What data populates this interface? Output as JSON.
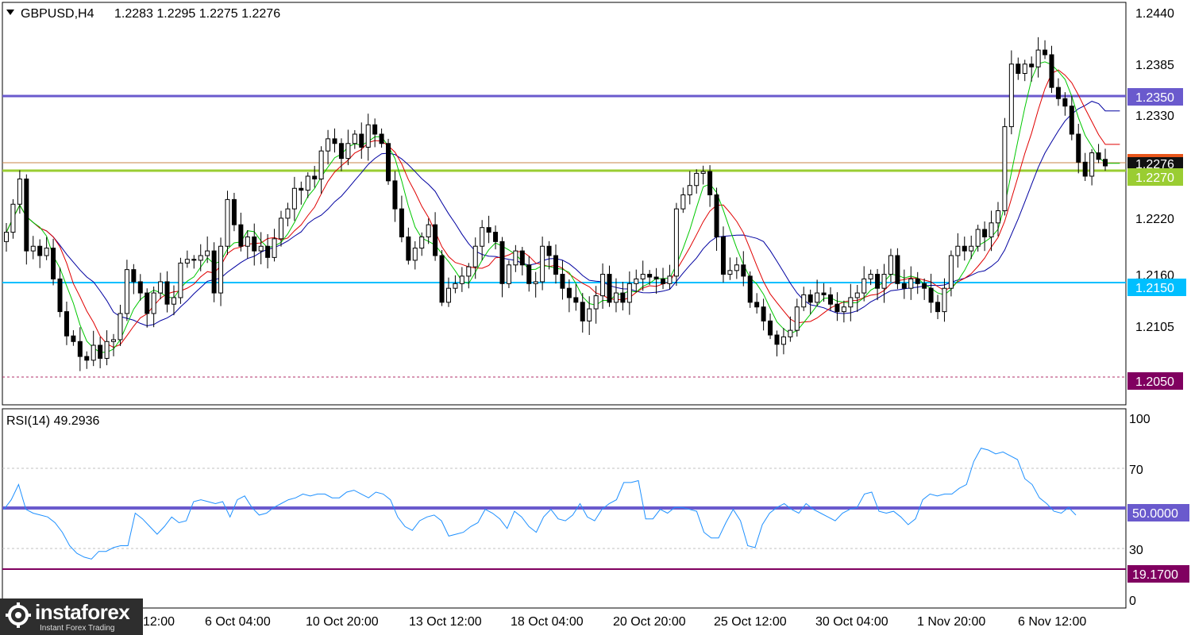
{
  "header": {
    "symbol": "GBPUSD,H4",
    "ohlc": "1.2283 1.2295 1.2275 1.2276",
    "collapse_icon": "triangle-down-icon"
  },
  "rsi_header": "RSI(14) 49.2936",
  "colors": {
    "background": "#ffffff",
    "candle": "#000000",
    "ma_fast": "#00c800",
    "ma_mid": "#e00000",
    "ma_slow": "#0000a0",
    "resistance_line": "#6a5acd",
    "support_line": "#00bfff",
    "green_line": "#9acd32",
    "purple_tag": "#800060",
    "rsi_line": "#1e90ff",
    "rsi_mid_line": "#6a5acd"
  },
  "price_axis": {
    "ticks": [
      "1.2440",
      "1.2385",
      "1.2330",
      "1.2220",
      "1.2160",
      "1.2105"
    ]
  },
  "rsi_axis": {
    "ticks": [
      "100",
      "70",
      "30",
      "0"
    ]
  },
  "time_axis": {
    "labels": [
      "6 Oct 04:00",
      "10 Oct 20:00",
      "13 Oct 12:00",
      "18 Oct 04:00",
      "20 Oct 20:00",
      "25 Oct 12:00",
      "30 Oct 04:00",
      "1 Nov 20:00",
      "6 Nov 12:00"
    ],
    "partial_label": "12:00"
  },
  "levels": {
    "l1": {
      "value": 1.235,
      "label": "1.2350"
    },
    "l2": {
      "value": 1.227,
      "label": "1.2270"
    },
    "l3": {
      "value": 1.215,
      "label": "1.2150"
    },
    "l4": {
      "value": 1.205,
      "label": "1.2050"
    },
    "current": {
      "value": 1.2276,
      "label": "1.2276"
    }
  },
  "rsi_levels": {
    "mid": {
      "value": 50,
      "label": "50.0000"
    },
    "low": {
      "value": 19.17,
      "label": "19.1700"
    }
  },
  "logo": {
    "name": "instaforex",
    "tagline": "Instant Forex Trading"
  },
  "chart_data": [
    {
      "type": "candlestick",
      "title": "GBPUSD,H4",
      "ylim": [
        1.2032,
        1.2462
      ],
      "close_series": [
        1.2205,
        1.2235,
        1.2262,
        1.2185,
        1.219,
        1.218,
        1.2188,
        1.2155,
        1.212,
        1.2094,
        1.2088,
        1.2072,
        1.2068,
        1.2084,
        1.207,
        1.2088,
        1.209,
        1.2118,
        1.2165,
        1.2152,
        1.214,
        1.2118,
        1.214,
        1.2152,
        1.2128,
        1.2135,
        1.2172,
        1.2176,
        1.2175,
        1.218,
        1.2185,
        1.214,
        1.219,
        1.224,
        1.2213,
        1.219,
        1.22,
        1.2185,
        1.219,
        1.2178,
        1.2198,
        1.222,
        1.223,
        1.2252,
        1.225,
        1.2265,
        1.2262,
        1.2292,
        1.2305,
        1.23,
        1.2284,
        1.23,
        1.231,
        1.2296,
        1.232,
        1.231,
        1.23,
        1.226,
        1.223,
        1.22,
        1.2175,
        1.2188,
        1.22,
        1.2213,
        1.218,
        1.213,
        1.2145,
        1.215,
        1.2158,
        1.2168,
        1.219,
        1.221,
        1.2205,
        1.2195,
        1.215,
        1.217,
        1.2185,
        1.217,
        1.215,
        1.2152,
        1.219,
        1.218,
        1.216,
        1.2145,
        1.2135,
        1.213,
        1.211,
        1.2123,
        1.2137,
        1.216,
        1.213,
        1.214,
        1.213,
        1.215,
        1.2155,
        1.216,
        1.2157,
        1.2155,
        1.215,
        1.2158,
        1.223,
        1.2245,
        1.2255,
        1.2268,
        1.227,
        1.2245,
        1.22,
        1.216,
        1.2164,
        1.217,
        1.2158,
        1.213,
        1.2125,
        1.211,
        1.2095,
        1.2085,
        1.2093,
        1.21,
        1.2125,
        1.2138,
        1.213,
        1.214,
        1.2138,
        1.2128,
        1.212,
        1.2125,
        1.2135,
        1.214,
        1.2155,
        1.216,
        1.2145,
        1.216,
        1.218,
        1.215,
        1.2145,
        1.2155,
        1.215,
        1.2145,
        1.213,
        1.212,
        1.2145,
        1.218,
        1.219,
        1.2185,
        1.219,
        1.2208,
        1.22,
        1.2215,
        1.2228,
        1.2318,
        1.2385,
        1.2375,
        1.2385,
        1.2382,
        1.24,
        1.2395,
        1.236,
        1.2348,
        1.234,
        1.231,
        1.228,
        1.2265,
        1.229,
        1.2283,
        1.2276
      ]
    },
    {
      "type": "line",
      "title": "RSI(14) 49.2936",
      "ylim": [
        0,
        100
      ],
      "hlines": [
        70,
        30
      ],
      "values": [
        52,
        57,
        65,
        52,
        50,
        49,
        48,
        45,
        40,
        33,
        29,
        27,
        26,
        30,
        30,
        32,
        33,
        33,
        50,
        47,
        43,
        39,
        43,
        48,
        45,
        46,
        56,
        57,
        56,
        55,
        56,
        48,
        57,
        59,
        53,
        49,
        50,
        53,
        55,
        57,
        58,
        60,
        59,
        60,
        60,
        58,
        58,
        61,
        62,
        60,
        58,
        61,
        60,
        57,
        48,
        43,
        41,
        46,
        48,
        49,
        46,
        38,
        39,
        40,
        43,
        45,
        52,
        50,
        47,
        42,
        51,
        48,
        43,
        40,
        48,
        52,
        47,
        46,
        49,
        55,
        48,
        46,
        52,
        55,
        57,
        66,
        66,
        67,
        47,
        47,
        52,
        50,
        53,
        53,
        52,
        51,
        40,
        37,
        37,
        45,
        52,
        46,
        33,
        32,
        44,
        50,
        53,
        55,
        52,
        50,
        55,
        52,
        50,
        48,
        46,
        50,
        52,
        53,
        60,
        61,
        51,
        50,
        51,
        48,
        44,
        47,
        57,
        60,
        59,
        60,
        60,
        63,
        65,
        77,
        84,
        83,
        81,
        82,
        80,
        78,
        68,
        65,
        58,
        55,
        51,
        50,
        53,
        49
      ]
    }
  ]
}
